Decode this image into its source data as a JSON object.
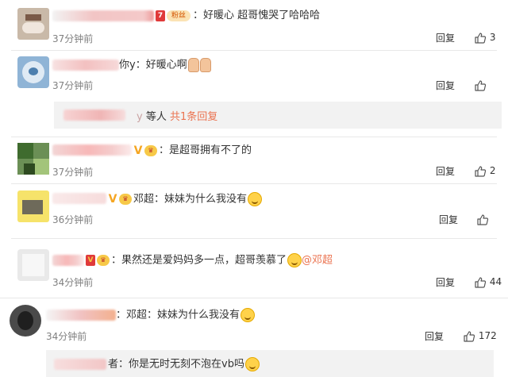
{
  "comments": [
    {
      "text": "：好暖心 超哥愧哭了哈哈哈",
      "time": "37分钟前",
      "reply": "回复",
      "likes": "3",
      "badge": "粉丝"
    },
    {
      "text": "你y：好暖心啊",
      "time": "37分钟前",
      "reply": "回复",
      "likes": ""
    },
    {
      "text": "：是超哥拥有不了的",
      "time": "37分钟前",
      "reply": "回复",
      "likes": "2"
    },
    {
      "text": "邓超：妹妹为什么我没有",
      "time": "36分钟前",
      "reply": "回复",
      "likes": ""
    },
    {
      "text": "：果然还是爱妈妈多一点，超哥羡慕了",
      "mention": "@邓超",
      "time": "34分钟前",
      "reply": "回复",
      "likes": "44"
    },
    {
      "text": "：邓超：妹妹为什么我没有",
      "time": "34分钟前",
      "reply": "回复",
      "likes": "172"
    },
    {
      "text": "者：你是无时无刻不泡在vb吗"
    }
  ],
  "subreply": {
    "who": "等人",
    "more": "共1条回复",
    "name_suffix": "y"
  },
  "icons": {
    "like": "thumbs-up-icon",
    "emoji": "smiley-emoji-icon",
    "vip": "v-badge-icon"
  },
  "colors": {
    "accent": "#eb7350",
    "meta": "#808080",
    "divider": "#e8e8e8",
    "subbox": "#f2f2f2"
  }
}
